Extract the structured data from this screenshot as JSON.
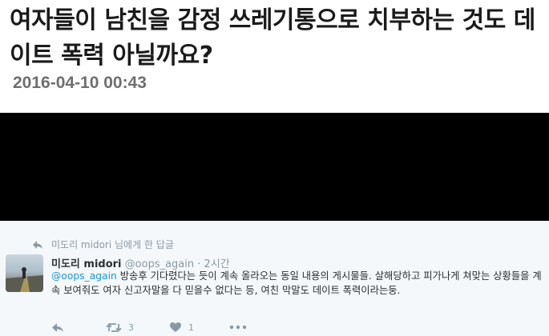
{
  "article": {
    "headline": "여자들이 남친을 감정 쓰레기통으로 치부하는 것도 데이트 폭력 아닐까요?",
    "date": "2016-04-10 00:43"
  },
  "tweet": {
    "reply_context": "미도리 midori 님에게 한 답글",
    "author_name": "미도리 midori",
    "handle": "@oops_again",
    "separator": "·",
    "time": "2시간",
    "mention": "@oops_again",
    "body": " 방송후 기다렸다는 듯이 계속 올라오는 동일 내용의 게시물들. 살해당하고 피가나게 쳐맞는 상황들을 계속 보여줘도 여자 신고자말을 다 믿을수 없다는 등, 여친 막말도 데이트 폭력이라는둥.",
    "actions": {
      "retweet_count": "3",
      "like_count": "1"
    },
    "icons": [
      "reply-icon",
      "retweet-icon",
      "heart-icon",
      "more-icon"
    ],
    "colors": {
      "link": "#1b95e0",
      "muted": "#8899a6",
      "background": "#f5f8fa"
    }
  }
}
